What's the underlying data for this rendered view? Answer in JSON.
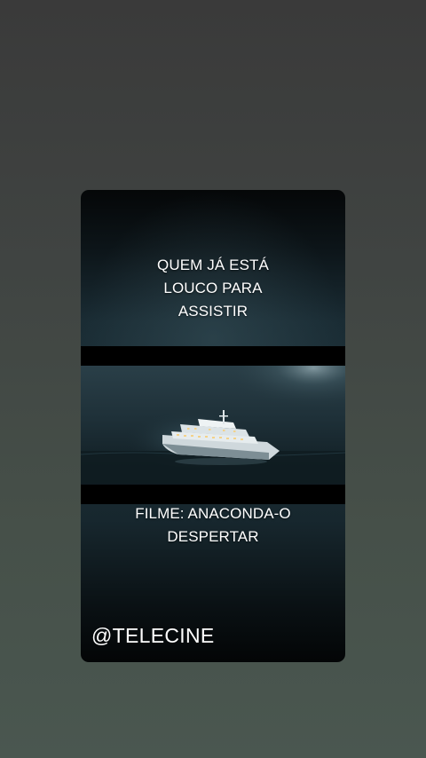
{
  "story": {
    "caption_top_lines": [
      "QUEM JÁ ESTÁ",
      "LOUCO PARA",
      "ASSISTIR"
    ],
    "caption_bottom_lines": [
      "FILME: ANACONDA-O",
      "DESPERTAR"
    ],
    "handle": "@TELECINE"
  },
  "colors": {
    "page_bg_top": "#3a3a3a",
    "page_bg_bottom": "#4a5750",
    "card_bg": "#1d3038",
    "text": "#ffffff",
    "band": "#000000"
  }
}
